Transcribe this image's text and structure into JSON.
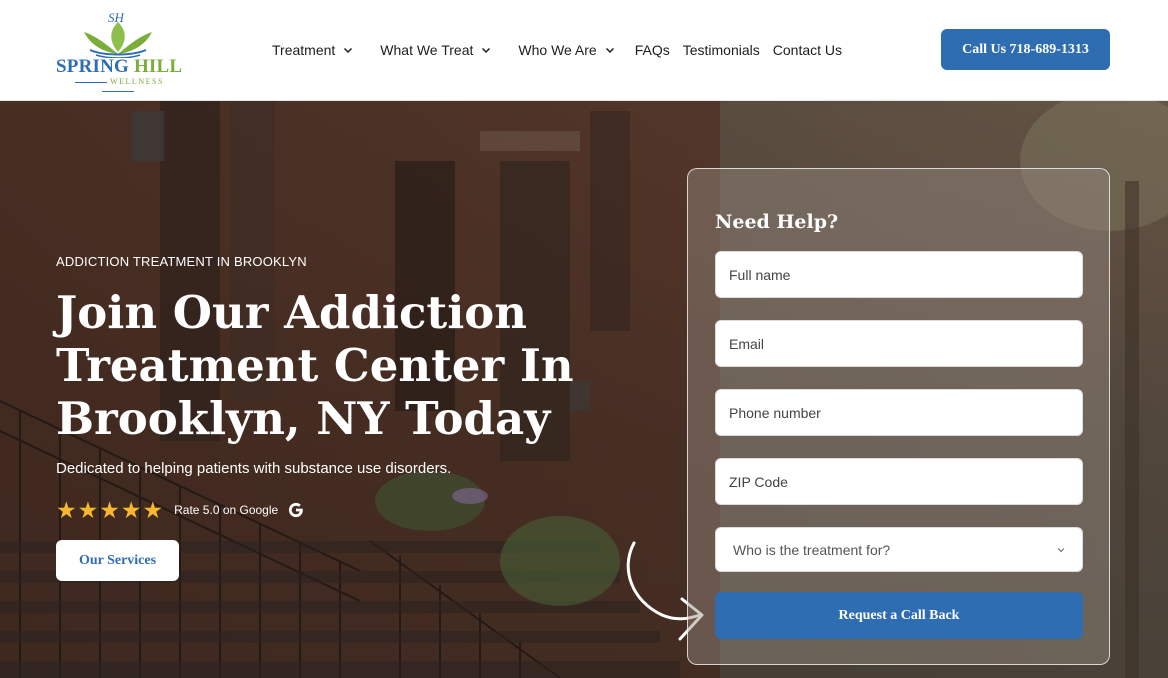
{
  "brand": {
    "monogram": "SH",
    "name_part1": "SPRING",
    "name_part2": "HILL",
    "tagline": "WELLNESS",
    "colors": {
      "primary": "#2f6db3",
      "green": "#7aad3a"
    }
  },
  "nav": {
    "items": [
      {
        "label": "Treatment",
        "has_dropdown": true
      },
      {
        "label": "What We Treat",
        "has_dropdown": true
      },
      {
        "label": "Who We Are",
        "has_dropdown": true
      },
      {
        "label": "FAQs",
        "has_dropdown": false
      },
      {
        "label": "Testimonials",
        "has_dropdown": false
      },
      {
        "label": "Contact Us",
        "has_dropdown": false
      }
    ],
    "call_label": "Call Us 718-689-1313"
  },
  "hero": {
    "eyebrow": "ADDICTION TREATMENT IN BROOKLYN",
    "title": "Join Our Addiction Treatment Center In Brooklyn, NY Today",
    "subtitle": "Dedicated to helping patients with substance use disorders.",
    "rating": {
      "stars": 5,
      "text": "Rate 5.0 on Google",
      "icon": "google-icon"
    },
    "services_label": "Our Services"
  },
  "form": {
    "title": "Need Help?",
    "fields": {
      "full_name": {
        "placeholder": "Full name",
        "value": ""
      },
      "email": {
        "placeholder": "Email",
        "value": ""
      },
      "phone": {
        "placeholder": "Phone number",
        "value": ""
      },
      "zip": {
        "placeholder": "ZIP Code",
        "value": ""
      }
    },
    "select": {
      "placeholder": "Who is the treatment for?"
    },
    "submit_label": "Request a Call Back"
  }
}
